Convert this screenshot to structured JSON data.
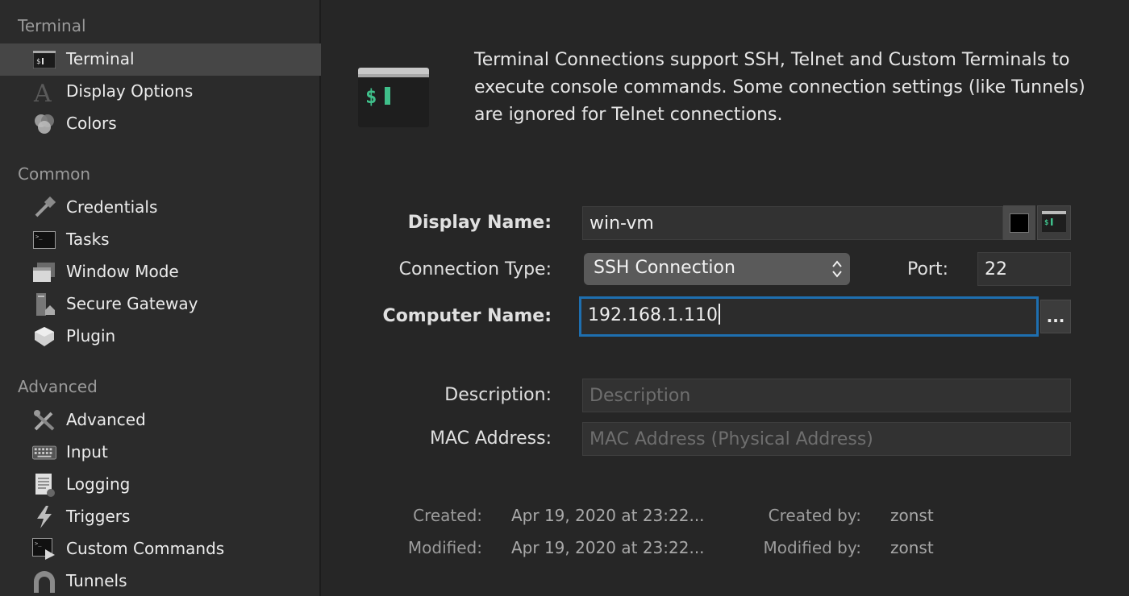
{
  "sidebar": {
    "sections": [
      {
        "header": "Terminal",
        "items": [
          {
            "label": "Terminal",
            "icon": "terminal-icon",
            "selected": true
          },
          {
            "label": "Display Options",
            "icon": "font-icon"
          },
          {
            "label": "Colors",
            "icon": "colors-icon"
          }
        ]
      },
      {
        "header": "Common",
        "items": [
          {
            "label": "Credentials",
            "icon": "key-icon"
          },
          {
            "label": "Tasks",
            "icon": "tasks-icon"
          },
          {
            "label": "Window Mode",
            "icon": "window-mode-icon"
          },
          {
            "label": "Secure Gateway",
            "icon": "secure-gateway-icon"
          },
          {
            "label": "Plugin",
            "icon": "plugin-icon"
          }
        ]
      },
      {
        "header": "Advanced",
        "items": [
          {
            "label": "Advanced",
            "icon": "tools-icon"
          },
          {
            "label": "Input",
            "icon": "keyboard-icon"
          },
          {
            "label": "Logging",
            "icon": "logging-icon"
          },
          {
            "label": "Triggers",
            "icon": "triggers-icon"
          },
          {
            "label": "Custom Commands",
            "icon": "custom-commands-icon"
          },
          {
            "label": "Tunnels",
            "icon": "tunnels-icon"
          }
        ]
      }
    ]
  },
  "intro": {
    "text": "Terminal Connections support SSH, Telnet and Custom Terminals to execute console commands. Some connection settings (like Tunnels) are ignored for Telnet connections.",
    "icon_prompt": "$"
  },
  "form": {
    "display_name_label": "Display Name:",
    "display_name_value": "win-vm",
    "connection_type_label": "Connection Type:",
    "connection_type_value": "SSH Connection",
    "port_label": "Port:",
    "port_value": "22",
    "computer_name_label": "Computer Name:",
    "computer_name_value": "192.168.1.110",
    "browse_button": "...",
    "description_label": "Description:",
    "description_placeholder": "Description",
    "mac_label": "MAC Address:",
    "mac_placeholder": "MAC Address (Physical Address)",
    "mini_icon_prompt": "$"
  },
  "meta": {
    "created_label": "Created:",
    "created_value": "Apr 19, 2020 at 23:22...",
    "created_by_label": "Created by:",
    "created_by_value": "zonst",
    "modified_label": "Modified:",
    "modified_value": "Apr 19, 2020 at 23:22...",
    "modified_by_label": "Modified by:",
    "modified_by_value": "zonst"
  },
  "colors": {
    "accent_focus": "#1e6fb0",
    "terminal_green": "#3fbf8a",
    "selected_row": "#464646"
  }
}
